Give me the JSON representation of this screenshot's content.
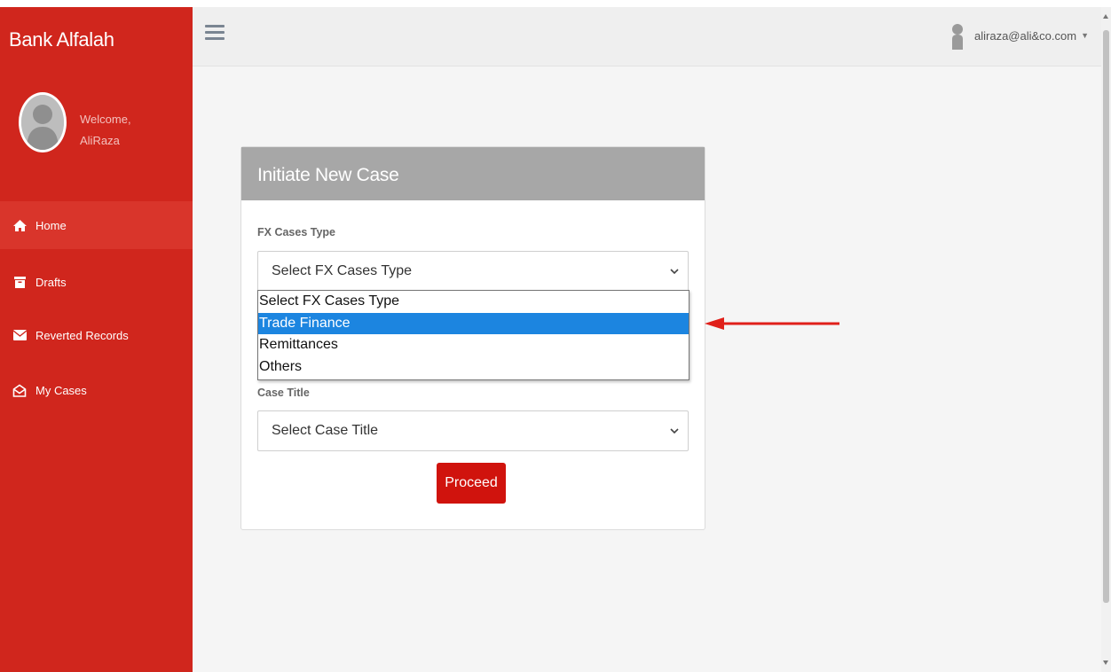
{
  "app": {
    "brand": "Bank Alfalah"
  },
  "profile": {
    "welcome": "Welcome,",
    "name": "AliRaza"
  },
  "sidebar": {
    "items": [
      {
        "label": "Home",
        "icon": "home-icon"
      },
      {
        "label": "Drafts",
        "icon": "archive-icon"
      },
      {
        "label": "Reverted Records",
        "icon": "envelope-icon"
      },
      {
        "label": "My Cases",
        "icon": "envelope-open-icon"
      }
    ]
  },
  "topbar": {
    "user_email": "aliraza@ali&co.com"
  },
  "card": {
    "title": "Initiate New Case",
    "fx_label": "FX Cases Type",
    "fx_value": "Select FX Cases Type",
    "fx_options": [
      "Select FX Cases Type",
      "Trade Finance",
      "Remittances",
      "Others"
    ],
    "fx_highlighted": "Trade Finance",
    "case_title_label": "Case Title",
    "case_title_value": "Select Case Title",
    "proceed_label": "Proceed"
  },
  "colors": {
    "sidebar": "#d0261d",
    "button": "#d0130d",
    "highlight": "#1c85e0",
    "annotation_arrow": "#e0201a"
  }
}
